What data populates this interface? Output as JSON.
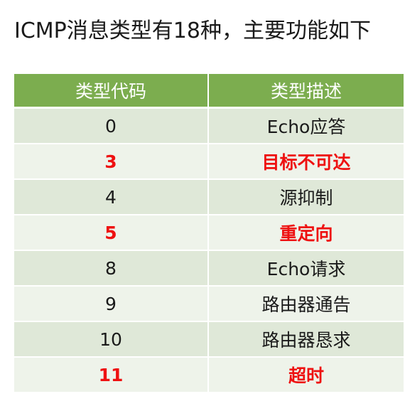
{
  "title": "ICMP消息类型有18种，主要功能如下",
  "table": {
    "headers": [
      "类型代码",
      "类型描述"
    ],
    "rows": [
      {
        "code": "0",
        "desc": "Echo应答",
        "highlight": false
      },
      {
        "code": "3",
        "desc": "目标不可达",
        "highlight": true
      },
      {
        "code": "4",
        "desc": "源抑制",
        "highlight": false
      },
      {
        "code": "5",
        "desc": "重定向",
        "highlight": true
      },
      {
        "code": "8",
        "desc": "Echo请求",
        "highlight": false
      },
      {
        "code": "9",
        "desc": "路由器通告",
        "highlight": false
      },
      {
        "code": "10",
        "desc": "路由器恳求",
        "highlight": false
      },
      {
        "code": "11",
        "desc": "超时",
        "highlight": true
      }
    ]
  },
  "colors": {
    "header_bg": "#7cad4f",
    "row_odd": "#dfe8d8",
    "row_even": "#eef3ea",
    "highlight_text": "#ee1111"
  }
}
